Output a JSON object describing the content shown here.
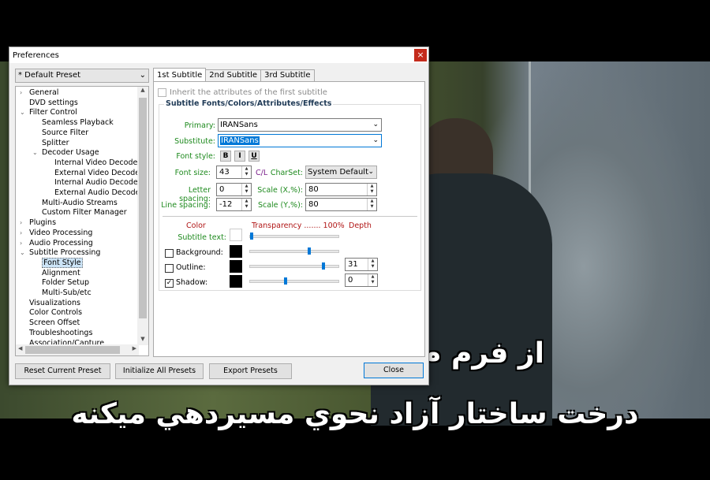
{
  "window": {
    "title": "Preferences",
    "close_glyph": "×"
  },
  "preset": {
    "value": "* Default Preset"
  },
  "tree": {
    "items": [
      {
        "label": "General",
        "level": 0,
        "exp": "›"
      },
      {
        "label": "DVD settings",
        "level": 0,
        "exp": ""
      },
      {
        "label": "Filter Control",
        "level": 0,
        "exp": "⌄"
      },
      {
        "label": "Seamless Playback",
        "level": 1,
        "exp": ""
      },
      {
        "label": "Source Filter",
        "level": 1,
        "exp": ""
      },
      {
        "label": "Splitter",
        "level": 1,
        "exp": ""
      },
      {
        "label": "Decoder Usage",
        "level": 1,
        "exp": "⌄"
      },
      {
        "label": "Internal Video Decoder",
        "level": 2,
        "exp": ""
      },
      {
        "label": "External Video Decoder",
        "level": 2,
        "exp": ""
      },
      {
        "label": "Internal Audio Decoder",
        "level": 2,
        "exp": ""
      },
      {
        "label": "External Audio Decoder",
        "level": 2,
        "exp": ""
      },
      {
        "label": "Multi-Audio Streams",
        "level": 1,
        "exp": ""
      },
      {
        "label": "Custom Filter Manager",
        "level": 1,
        "exp": ""
      },
      {
        "label": "Plugins",
        "level": 0,
        "exp": "›"
      },
      {
        "label": "Video Processing",
        "level": 0,
        "exp": "›"
      },
      {
        "label": "Audio Processing",
        "level": 0,
        "exp": "›"
      },
      {
        "label": "Subtitle Processing",
        "level": 0,
        "exp": "⌄"
      },
      {
        "label": "Font Style",
        "level": 1,
        "exp": "",
        "selected": true
      },
      {
        "label": "Alignment",
        "level": 1,
        "exp": ""
      },
      {
        "label": "Folder Setup",
        "level": 1,
        "exp": ""
      },
      {
        "label": "Multi-Sub/etc",
        "level": 1,
        "exp": ""
      },
      {
        "label": "Visualizations",
        "level": 0,
        "exp": ""
      },
      {
        "label": "Color Controls",
        "level": 0,
        "exp": ""
      },
      {
        "label": "Screen Offset",
        "level": 0,
        "exp": ""
      },
      {
        "label": "Troubleshootings",
        "level": 0,
        "exp": ""
      },
      {
        "label": "Association/Capture",
        "level": 0,
        "exp": ""
      }
    ]
  },
  "tabs": [
    "1st Subtitle",
    "2nd Subtitle",
    "3rd Subtitle"
  ],
  "inherit_label": "Inherit the attributes of the first subtitle",
  "group_title": "Subtitle Fonts/Colors/Attributes/Effects",
  "fields": {
    "primary_label": "Primary:",
    "primary_value": "IRANSans",
    "substitute_label": "Substitute:",
    "substitute_value": "IRANSans",
    "font_style_label": "Font style:",
    "bold": "B",
    "italic": "I",
    "underline": "U",
    "font_size_label": "Font size:",
    "font_size_value": "43",
    "cl": "C/L",
    "charset_label": "CharSet:",
    "charset_value": "System Default",
    "letter_spacing_label": "Letter spacing:",
    "letter_spacing_value": "0",
    "scale_x_label": "Scale (X,%):",
    "scale_x_value": "80",
    "line_spacing_label": "Line spacing:",
    "line_spacing_value": "-12",
    "scale_y_label": "Scale (Y,%):",
    "scale_y_value": "80"
  },
  "colors": {
    "color_header": "Color",
    "transparency_header": "Transparency ....... 100%",
    "depth_header": "Depth",
    "subtitle_text_label": "Subtitle text:",
    "background_label": "Background:",
    "outline_label": "Outline:",
    "shadow_label": "Shadow:",
    "outline_depth": "31",
    "shadow_depth": "0",
    "check_glyph": "✓",
    "subtitle_text_transparency": 0.0,
    "background_transparency": 0.68,
    "outline_transparency": 0.84,
    "shadow_transparency": 0.4
  },
  "buttons": {
    "reset": "Reset Current Preset",
    "init": "Initialize All Presets",
    "export": "Export Presets",
    "close": "Close"
  },
  "arrows": {
    "down": "⌄",
    "up_small": "▲",
    "down_small": "▼",
    "left_small": "◀",
    "right_small": "▶"
  },
  "video_subtitles": {
    "line1": "از فرم م",
    "line2": "درخت ساختار آزاد نحوي مسيردهي ميكنه"
  }
}
